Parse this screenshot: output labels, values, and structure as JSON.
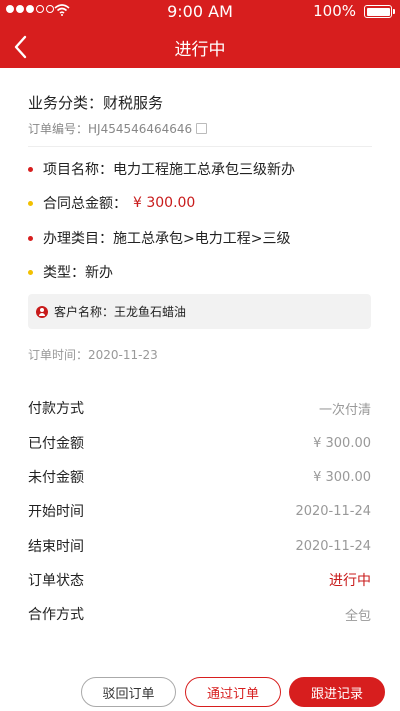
{
  "status_bar": {
    "time": "9:00 AM",
    "battery": "100%"
  },
  "header": {
    "title": "进行中"
  },
  "order": {
    "category": "业务分类：财税服务",
    "number": "订单编号：HJ454546464646",
    "items": [
      {
        "label": "项目名称：电力工程施工总承包三级新办",
        "bullet": "red"
      },
      {
        "label": "合同总金额：",
        "value": "¥ 300.00",
        "bullet": "yellow"
      },
      {
        "label": "办理类目：施工总承包>电力工程>三级",
        "bullet": "red"
      },
      {
        "label": "类型：新办",
        "bullet": "yellow"
      }
    ],
    "customer": "客户名称：王龙鱼石蜡油",
    "order_time": "订单时间：2020-11-23"
  },
  "details": [
    {
      "label": "付款方式",
      "value": "一次付清"
    },
    {
      "label": "已付金额",
      "value": "¥ 300.00"
    },
    {
      "label": "未付金额",
      "value": "¥ 300.00"
    },
    {
      "label": "开始时间",
      "value": "2020-11-24"
    },
    {
      "label": "结束时间",
      "value": "2020-11-24"
    },
    {
      "label": "订单状态",
      "value": "进行中"
    },
    {
      "label": "合作方式",
      "value": "全包"
    }
  ],
  "buttons": {
    "reject": "驳回订单",
    "approve": "通过订单",
    "follow": "跟进记录"
  },
  "colors": {
    "brand": "#d71e1e",
    "accent_yellow": "#f2c000"
  },
  "icons": [
    "back-chevron-icon",
    "copy-icon",
    "person-icon",
    "wifi-icon",
    "battery-icon"
  ]
}
